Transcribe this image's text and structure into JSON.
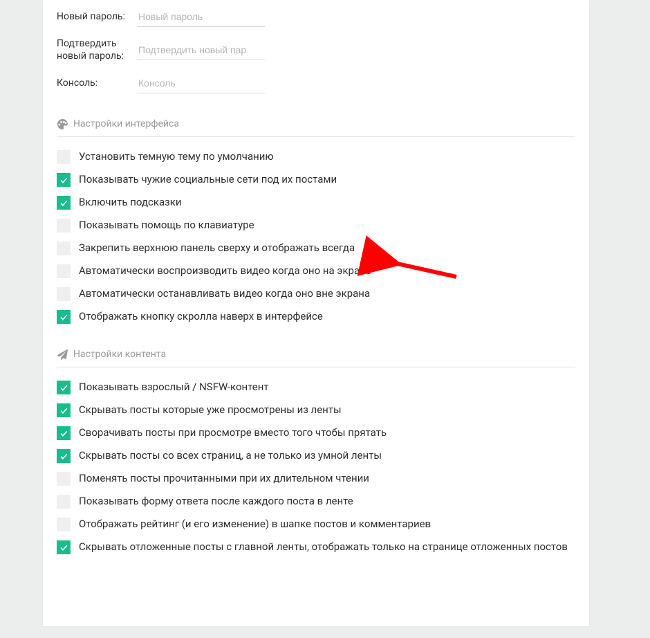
{
  "annotations": {
    "arrow_target": "interface.2"
  },
  "fields": {
    "new_password": {
      "label": "Новый пароль:",
      "placeholder": "Новый пароль",
      "value": ""
    },
    "confirm_password": {
      "label": "Подтвердить новый пароль:",
      "placeholder": "Подтвердить новый пар",
      "value": ""
    },
    "console": {
      "label": "Консоль:",
      "placeholder": "Консоль",
      "value": ""
    }
  },
  "sections": {
    "interface": {
      "title": "Настройки интерфейса",
      "icon": "palette-icon",
      "items": [
        {
          "id": "dark-theme",
          "label": "Установить темную тему по умолчанию",
          "checked": false
        },
        {
          "id": "show-socials",
          "label": "Показывать чужие социальные сети под их постами",
          "checked": true
        },
        {
          "id": "enable-tooltips",
          "label": "Включить подсказки",
          "checked": true
        },
        {
          "id": "keyboard-help",
          "label": "Показывать помощь по клавиатуре",
          "checked": false
        },
        {
          "id": "pin-top-panel",
          "label": "Закрепить верхнюю панель сверху и отображать всегда",
          "checked": false
        },
        {
          "id": "autoplay-onscreen",
          "label": "Автоматически воспроизводить видео когда оно на экране",
          "checked": false
        },
        {
          "id": "autopause-offscreen",
          "label": "Автоматически останавливать видео когда оно вне экрана",
          "checked": false
        },
        {
          "id": "scroll-top-button",
          "label": "Отображать кнопку скролла наверх в интерфейсе",
          "checked": true
        }
      ]
    },
    "content": {
      "title": "Настройки контента",
      "icon": "paper-plane-icon",
      "items": [
        {
          "id": "nsfw",
          "label": "Показывать взрослый / NSFW-контент",
          "checked": true
        },
        {
          "id": "hide-viewed",
          "label": "Скрывать посты которые уже просмотрены из ленты",
          "checked": true
        },
        {
          "id": "collapse-viewed",
          "label": "Сворачивать посты при просмотре вместо того чтобы прятать",
          "checked": true
        },
        {
          "id": "hide-all-pages",
          "label": "Скрывать посты со всех страниц, а не только из умной ленты",
          "checked": true
        },
        {
          "id": "mark-read-long",
          "label": "Поменять посты прочитанными при их длительном чтении",
          "checked": false
        },
        {
          "id": "reply-form-after",
          "label": "Показывать форму ответа после каждого поста в ленте",
          "checked": false
        },
        {
          "id": "show-rating-header",
          "label": "Отображать рейтинг (и его изменение) в шапке постов и комментариев",
          "checked": false
        },
        {
          "id": "hide-deferred",
          "label": "Скрывать отложенные посты с главной ленты, отображать только на странице отложенных постов",
          "checked": true
        }
      ]
    }
  }
}
